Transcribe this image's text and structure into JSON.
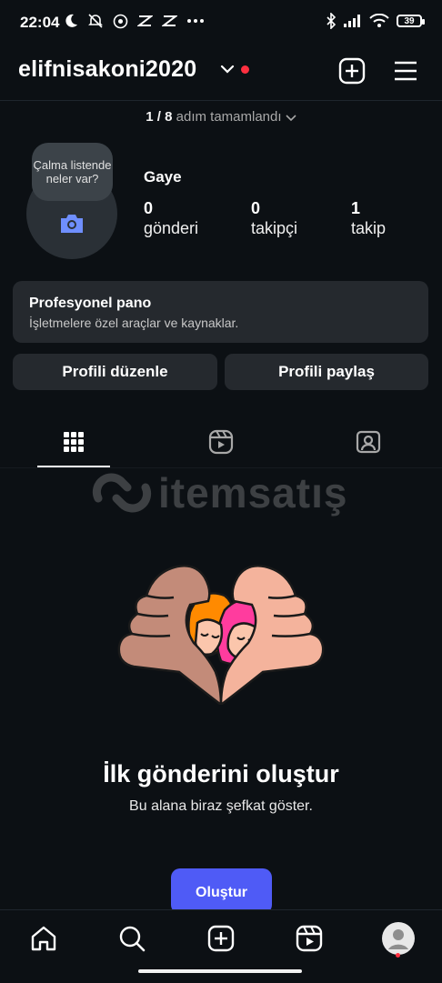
{
  "status_bar": {
    "time": "22:04",
    "battery": "39",
    "icons": [
      "moon-icon",
      "muted-bell-icon",
      "whatsapp-icon",
      "capcut-icon",
      "capcut-icon",
      "more-icon",
      "bluetooth-icon",
      "signal-icon",
      "wifi-icon",
      "battery-icon"
    ]
  },
  "header": {
    "username": "elifnisakoni2020",
    "accent_dot_color": "#ff3040"
  },
  "steps": {
    "progress": "1 / 8",
    "label": "adım tamamlandı"
  },
  "profile": {
    "bubble": "Çalma listende neler var?",
    "name": "Gaye",
    "stats": [
      {
        "value": "0",
        "label": "gönderi"
      },
      {
        "value": "0",
        "label": "takipçi"
      },
      {
        "value": "1",
        "label": "takip"
      }
    ]
  },
  "pro_dashboard": {
    "title": "Profesyonel pano",
    "subtitle": "İşletmelere özel araçlar ve kaynaklar."
  },
  "buttons": {
    "edit": "Profili düzenle",
    "share": "Profili paylaş"
  },
  "tabs": [
    "grid-icon",
    "reels-icon",
    "tagged-icon"
  ],
  "watermark": "itemsatış",
  "empty_state": {
    "title": "İlk gönderini oluştur",
    "subtitle": "Bu alana biraz şefkat göster.",
    "cta": "Oluştur",
    "cta_color": "#4f5bf6"
  },
  "bottom_nav": [
    "home-icon",
    "search-icon",
    "create-icon",
    "reels-icon",
    "profile-icon"
  ]
}
